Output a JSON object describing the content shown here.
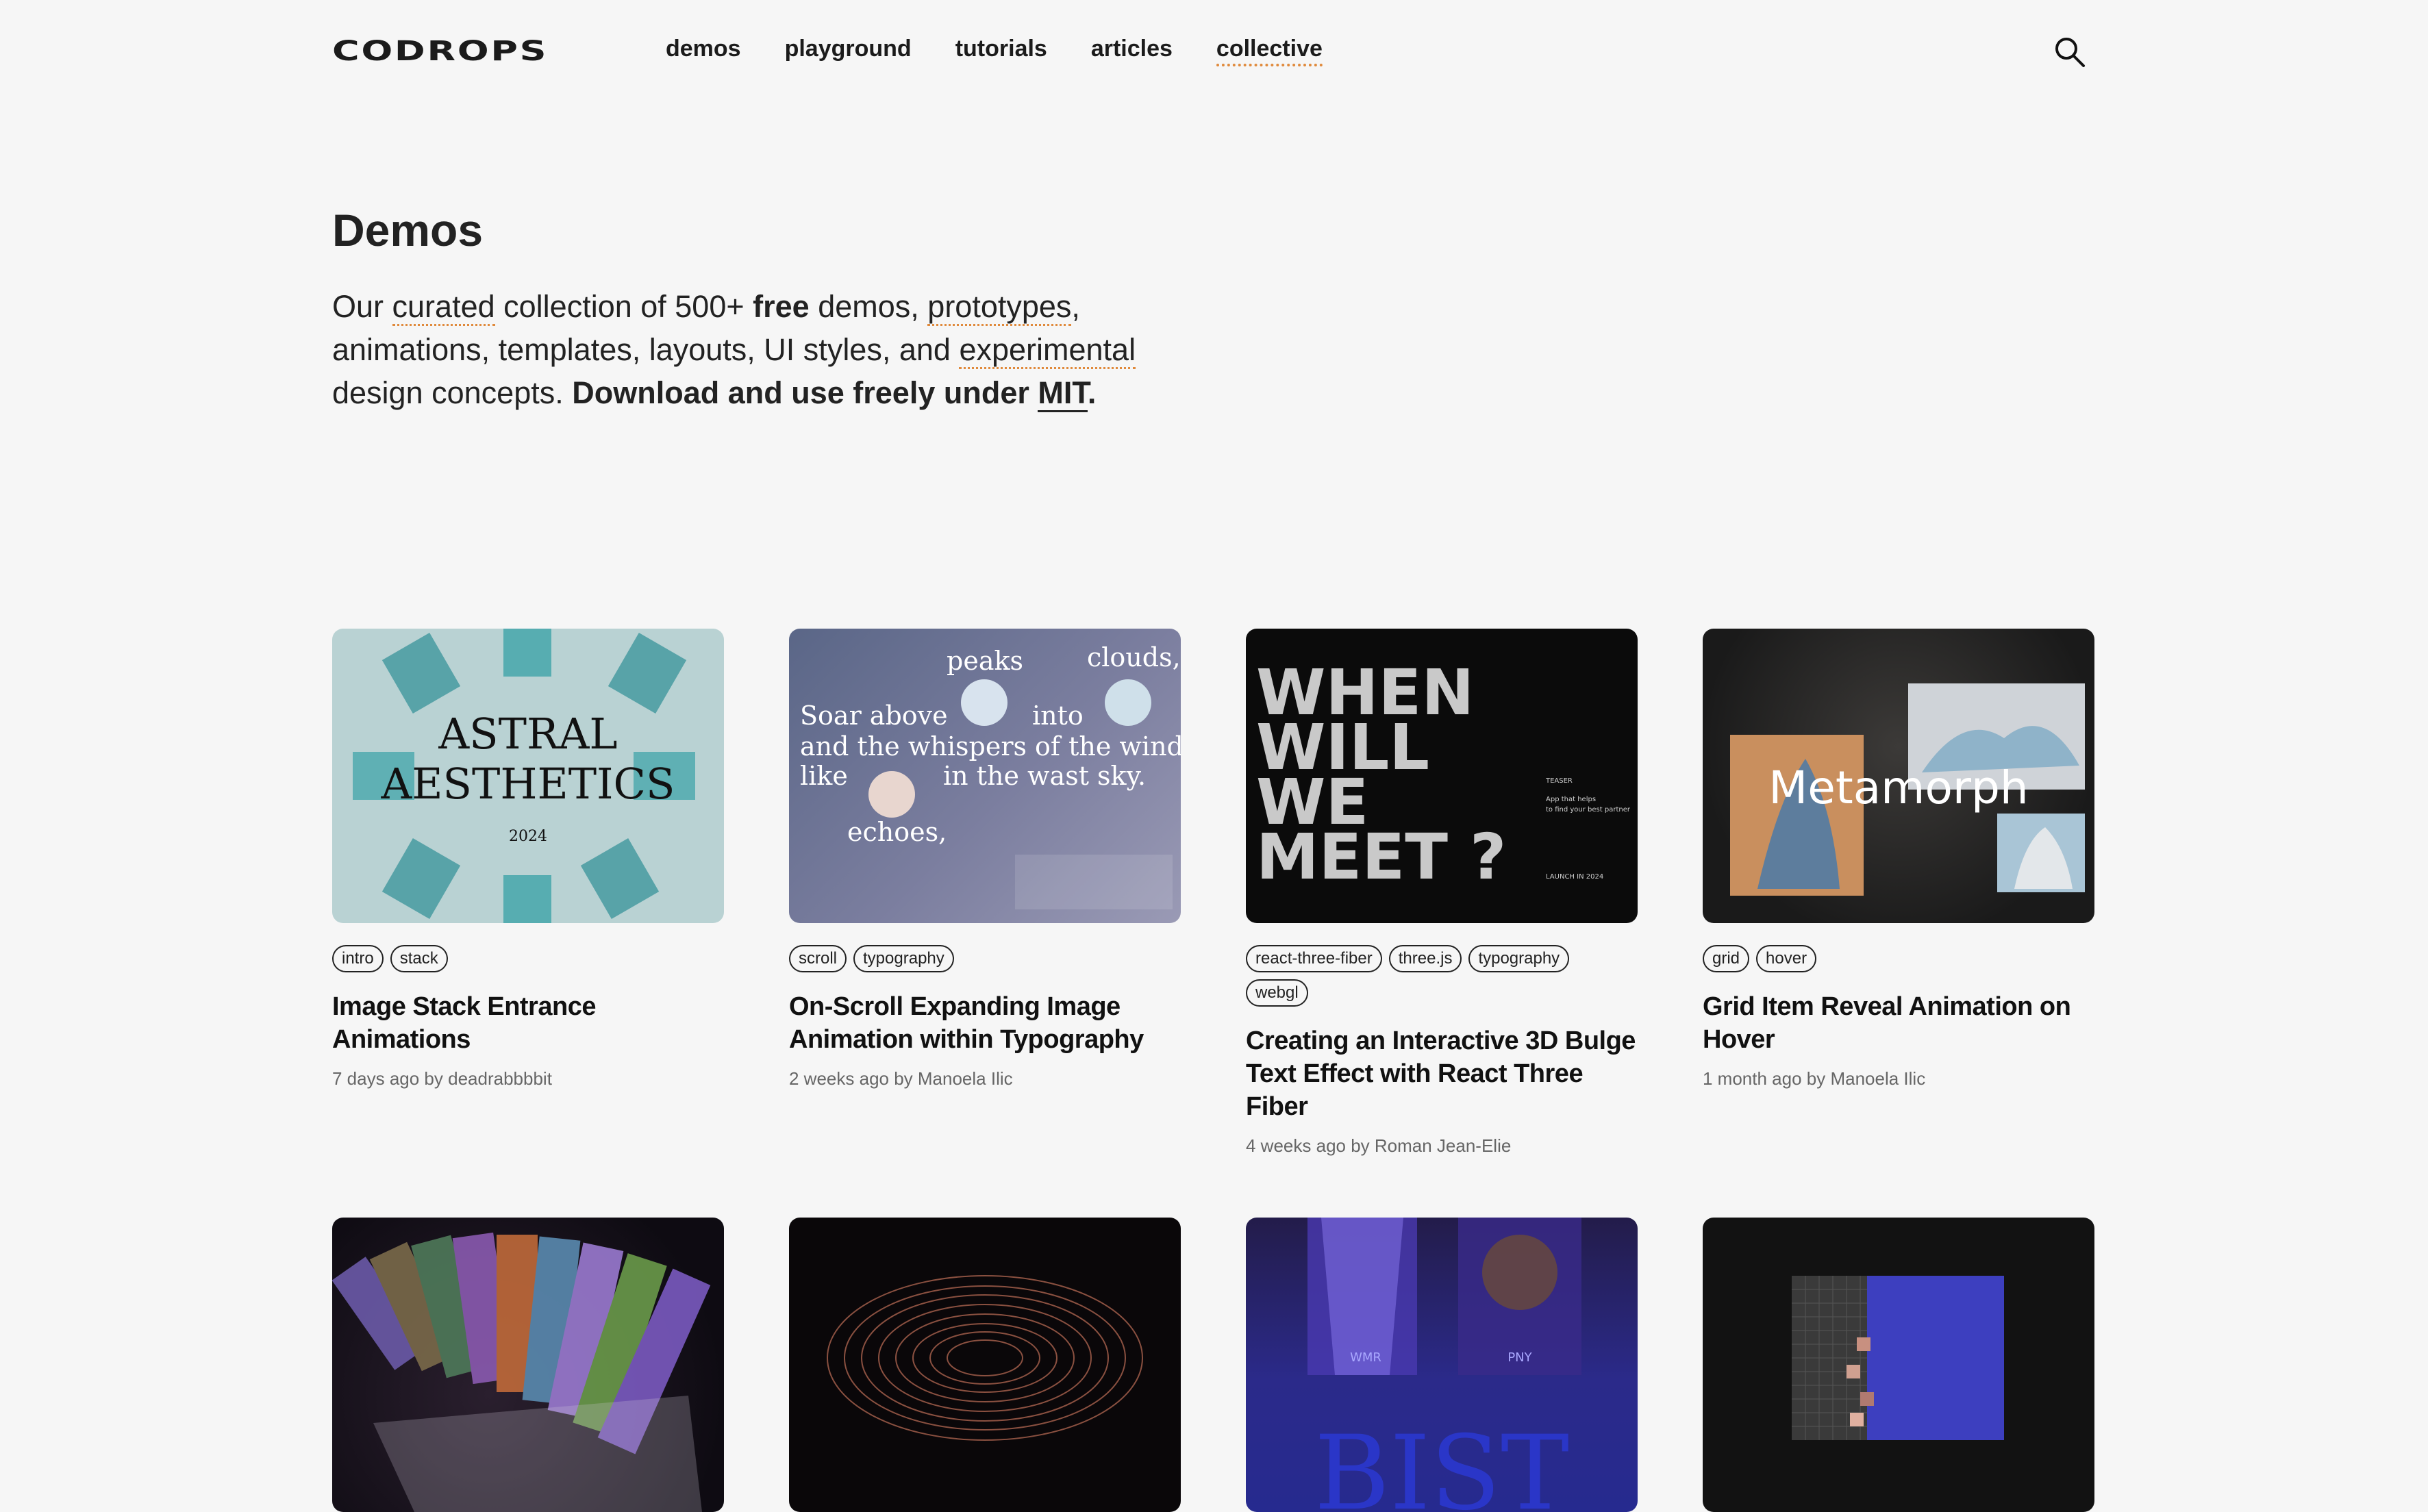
{
  "header": {
    "logo": "CODROPS",
    "nav": [
      "demos",
      "playground",
      "tutorials",
      "articles",
      "collective"
    ],
    "search_icon": "search-icon"
  },
  "intro": {
    "title": "Demos",
    "p1": "Our ",
    "curated": "curated",
    "p2": " collection of 500+ ",
    "free": "free",
    "p3": " demos, ",
    "prototypes": "prototypes",
    "p4": ", animations, templates, layouts, UI styles, and ",
    "experimental": "experimental",
    "p5": " design concepts. ",
    "download": "Download and use freely under ",
    "mit": "MIT",
    "period": "."
  },
  "cards": [
    {
      "tags": [
        "intro",
        "stack"
      ],
      "title": "Image Stack Entrance Animations",
      "meta": "7 days ago by deadrabbbbit",
      "art": {
        "l1": "ASTRAL",
        "l2": "AESTHETICS",
        "l3": "2024"
      }
    },
    {
      "tags": [
        "scroll",
        "typography"
      ],
      "title": "On-Scroll Expanding Image Animation within Typography",
      "meta": "2 weeks ago by Manoela Ilic",
      "art": {
        "w1": "peaks",
        "w2": "clouds,",
        "w3": "Soar above",
        "w4": "into",
        "w5": "and the whispers of the wind",
        "w6": "like",
        "w7": "in the wast sky.",
        "w8": "echoes,"
      }
    },
    {
      "tags": [
        "react-three-fiber",
        "three.js",
        "typography",
        "webgl"
      ],
      "title": "Creating an Interactive 3D Bulge Text Effect with React Three Fiber",
      "meta": "4 weeks ago by Roman Jean-Elie",
      "art": {
        "l1": "WHEN",
        "l2": "WILL",
        "l3": "WE",
        "l4": "MEET ?",
        "s1": "TEASER",
        "s2": "App that helps",
        "s3": "to find your best partner",
        "s4": "LAUNCH IN 2024"
      }
    },
    {
      "tags": [
        "grid",
        "hover"
      ],
      "title": "Grid Item Reveal Animation on Hover",
      "meta": "1 month ago by Manoela Ilic",
      "art": {
        "l1": "Metamorph"
      }
    },
    {
      "tags": [],
      "title": "",
      "meta": "",
      "art": {}
    },
    {
      "tags": [],
      "title": "",
      "meta": "",
      "art": {}
    },
    {
      "tags": [],
      "title": "",
      "meta": "",
      "art": {
        "l1": "BIST",
        "l2": "WMR",
        "l3": "PNY"
      }
    },
    {
      "tags": [],
      "title": "",
      "meta": "",
      "art": {}
    }
  ]
}
